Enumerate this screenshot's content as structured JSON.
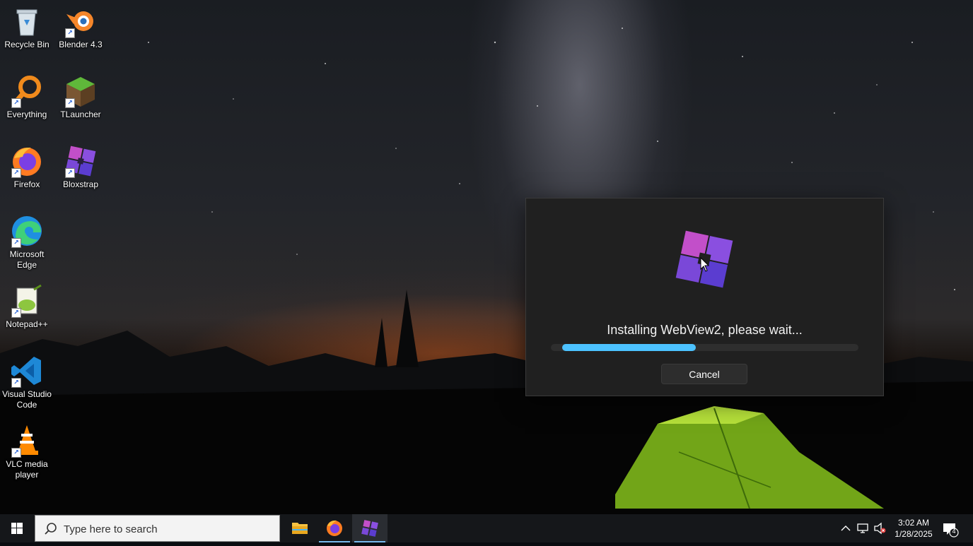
{
  "desktop": {
    "icons": [
      {
        "label": "Recycle Bin",
        "icon": "recycle-bin-icon"
      },
      {
        "label": "Blender 4.3",
        "icon": "blender-icon"
      },
      {
        "label": "Everything",
        "icon": "everything-search-icon"
      },
      {
        "label": "TLauncher",
        "icon": "tlauncher-icon"
      },
      {
        "label": "Firefox",
        "icon": "firefox-icon"
      },
      {
        "label": "Bloxstrap",
        "icon": "bloxstrap-icon"
      },
      {
        "label": "Microsoft Edge",
        "icon": "edge-icon"
      },
      {
        "label": "Notepad++",
        "icon": "notepad-plus-plus-icon"
      },
      {
        "label": "Visual Studio Code",
        "icon": "vscode-icon"
      },
      {
        "label": "VLC media player",
        "icon": "vlc-icon"
      }
    ]
  },
  "dialog": {
    "status_text": "Installing WebView2, please wait...",
    "progress": 0.47,
    "cancel_label": "Cancel",
    "logo": "bloxstrap-logo-icon",
    "accent_color": "#4cc2ff"
  },
  "taskbar": {
    "search_placeholder": "Type here to search",
    "pinned": [
      {
        "name": "file-explorer-icon"
      },
      {
        "name": "firefox-icon"
      },
      {
        "name": "bloxstrap-icon",
        "active": true
      }
    ],
    "clock_time": "3:02 AM",
    "clock_date": "1/28/2025",
    "notification_count": "4"
  }
}
